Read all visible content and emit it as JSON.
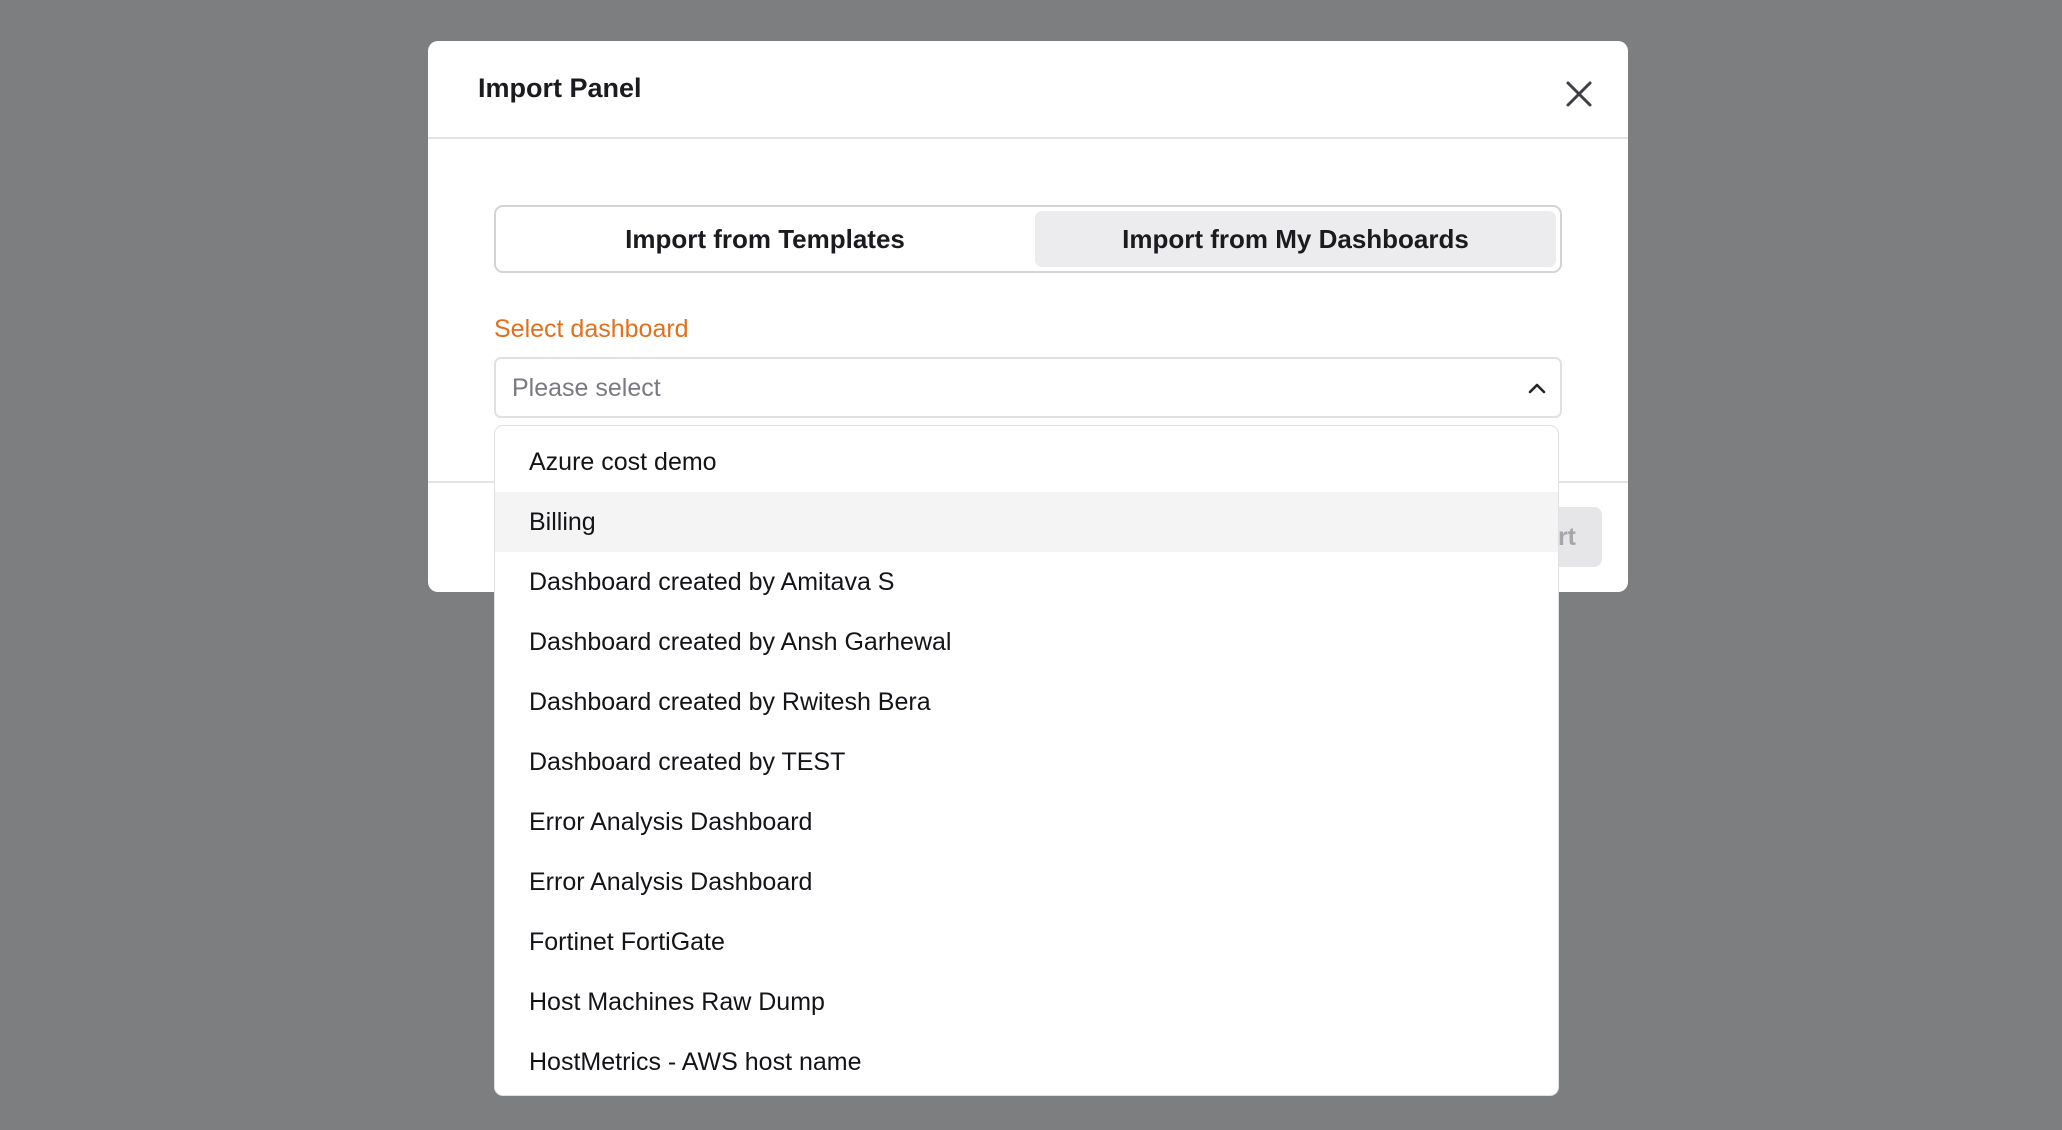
{
  "modal": {
    "title": "Import Panel",
    "tabs": [
      {
        "label": "Import from Templates",
        "selected": false
      },
      {
        "label": "Import from My Dashboards",
        "selected": true
      }
    ],
    "field_label": "Select dashboard",
    "select_placeholder": "Please select",
    "import_button_visible_text": "rt"
  },
  "dropdown": {
    "hovered_index": 1,
    "options": [
      "Azure cost demo",
      "Billing",
      "Dashboard created by Amitava S",
      "Dashboard created by Ansh Garhewal",
      "Dashboard created by Rwitesh Bera",
      "Dashboard created by TEST",
      "Error Analysis Dashboard",
      "Error Analysis Dashboard",
      "Fortinet FortiGate",
      "Host Machines Raw Dump",
      "HostMetrics - AWS host name"
    ]
  },
  "icons": {
    "close": "close-icon",
    "chevron": "chevron-up-icon"
  },
  "colors": {
    "backdrop": "#7d7e80",
    "label_accent": "#e0701e",
    "selected_tab_bg": "#ececee",
    "hover_row_bg": "#f4f4f5"
  }
}
